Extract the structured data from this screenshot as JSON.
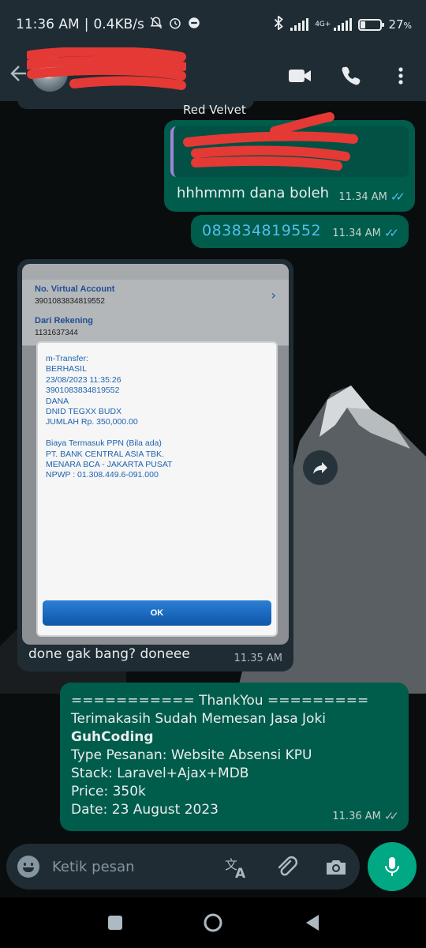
{
  "status_bar": {
    "time": "11:36 AM",
    "separator": "|",
    "speed": "0.4KB/s",
    "network_label": "4G+",
    "battery": "27",
    "battery_level": 0.27
  },
  "header": {
    "contact_name": "",
    "icons": [
      "back-arrow-icon",
      "video-call-icon",
      "voice-call-icon",
      "more-vert-icon"
    ]
  },
  "chat": {
    "top_sender_label": "Red Velvet",
    "reply_message": {
      "quoted_name": "",
      "quoted_text": "",
      "text": "hhhmmm dana boleh",
      "time": "11.34 AM",
      "status": "read"
    },
    "number_message": {
      "text": "083834819552",
      "time": "11.34 AM",
      "status": "read"
    },
    "image_message": {
      "receipt": {
        "row1_label": "No. Virtual Account",
        "row1_value": "3901083834819552",
        "row2_label": "Dari Rekening",
        "row2_value": "1131637344",
        "lines": [
          "m-Transfer:",
          "BERHASIL",
          "23/08/2023 11:35:26",
          "3901083834819552",
          "DANA",
          "DNID TEGXX BUDX",
          "JUMLAH Rp. 350,000.00",
          "",
          "Biaya Termasuk PPN (Bila ada)",
          "PT. BANK CENTRAL ASIA TBK.",
          "MENARA BCA - JAKARTA PUSAT",
          "NPWP : 01.308.449.6-091.000"
        ],
        "ok_label": "OK"
      },
      "caption": "done gak bang? doneee",
      "time": "11.35 AM"
    },
    "thankyou_message": {
      "lines": [
        "=========== ThankYou =========",
        "Terimakasih Sudah Memesan Jasa Joki",
        "GuhCoding",
        "Type Pesanan: Website Absensi KPU",
        "Stack: Laravel+Ajax+MDB",
        "Price: 350k",
        "Date: 23 August 2023"
      ],
      "time": "11.36 AM",
      "status": "delivered"
    }
  },
  "input_bar": {
    "placeholder": "Ketik pesan"
  },
  "colors": {
    "header_bg": "#1f2c33",
    "outgoing_bubble": "#005c4b",
    "incoming_bubble": "#1f2c33",
    "read_tick": "#53bdeb",
    "mic_button": "#00a884"
  }
}
